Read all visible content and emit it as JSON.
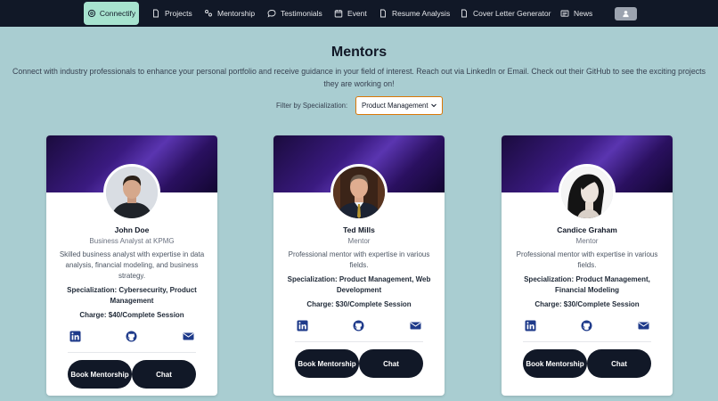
{
  "nav": {
    "brand": "Connectify",
    "items": [
      {
        "label": "Projects",
        "icon": "document-icon"
      },
      {
        "label": "Mentorship",
        "icon": "mentorship-icon"
      },
      {
        "label": "Testimonials",
        "icon": "chat-bubble-icon"
      },
      {
        "label": "Event",
        "icon": "calendar-icon"
      },
      {
        "label": "Resume Analysis",
        "icon": "document-icon"
      },
      {
        "label": "Cover Letter Generator",
        "icon": "document-icon"
      },
      {
        "label": "News",
        "icon": "newspaper-icon"
      }
    ],
    "profile_icon": "user-icon"
  },
  "page": {
    "title": "Mentors",
    "intro": "Connect with industry professionals to enhance your personal portfolio and receive guidance in your field of interest. Reach out via LinkedIn or Email. Check out their GitHub to see the exciting projects they are working on!",
    "filter_label": "Filter by Specialization:",
    "filter_value": "Product Management"
  },
  "mentors": [
    {
      "name": "John Doe",
      "title": "Business Analyst at KPMG",
      "bio": "Skilled business analyst with expertise in data analysis, financial modeling, and business strategy.",
      "specialization": "Specialization: Cybersecurity, Product Management",
      "charge": "Charge: $40/Complete Session",
      "book_label": "Book Mentorship",
      "chat_label": "Chat"
    },
    {
      "name": "Ted Mills",
      "title": "Mentor",
      "bio": "Professional mentor with expertise in various fields.",
      "specialization": "Specialization: Product Management, Web Development",
      "charge": "Charge: $30/Complete Session",
      "book_label": "Book Mentorship",
      "chat_label": "Chat"
    },
    {
      "name": "Candice Graham",
      "title": "Mentor",
      "bio": "Professional mentor with expertise in various fields.",
      "specialization": "Specialization: Product Management, Financial Modeling",
      "charge": "Charge: $30/Complete Session",
      "book_label": "Book Mentorship",
      "chat_label": "Chat"
    }
  ],
  "colors": {
    "navbar": "#111827",
    "brand_bg": "#a7e3cf",
    "page_bg": "#a9cdd1",
    "social_icon": "#1e3a8a",
    "button": "#111827"
  }
}
